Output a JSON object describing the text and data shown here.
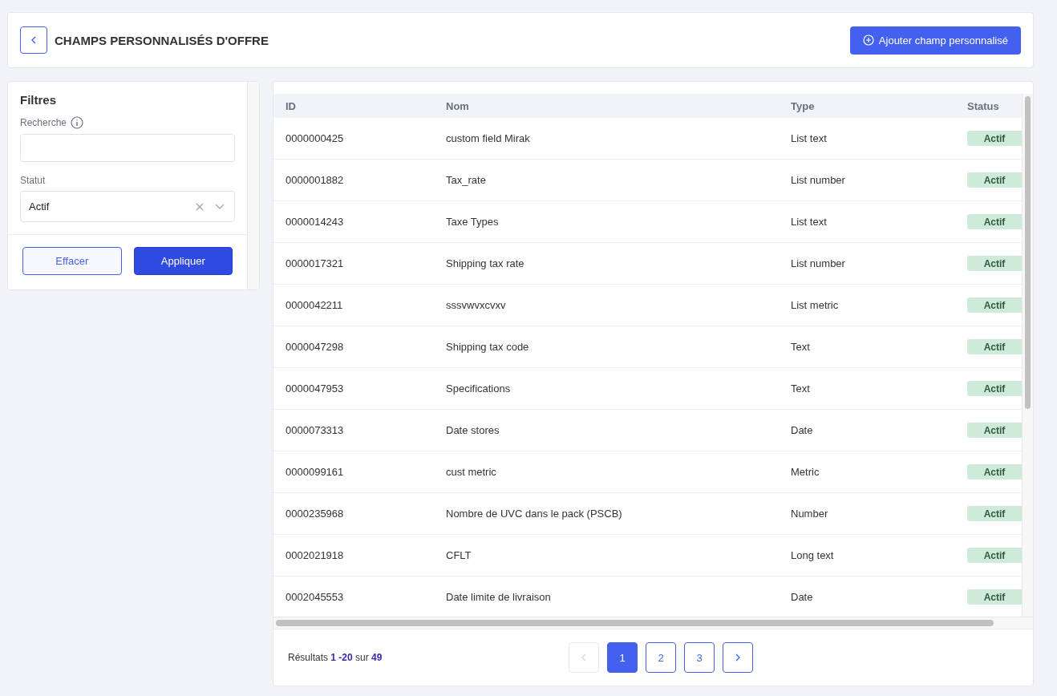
{
  "header": {
    "title": "CHAMPS PERSONNALISÉS D'OFFRE",
    "add_button": "Ajouter champ personnalisé"
  },
  "filters": {
    "title": "Filtres",
    "search": {
      "label": "Recherche"
    },
    "status": {
      "label": "Statut",
      "value": "Actif"
    },
    "buttons": [
      "Effacer",
      "Appliquer"
    ]
  },
  "table": {
    "columns": [
      "ID",
      "Nom",
      "Type",
      "Status"
    ],
    "rows": [
      {
        "id": "0000000425",
        "name": "custom field Mirak",
        "type": "List text",
        "status": "Actif"
      },
      {
        "id": "0000001882",
        "name": "Tax_rate",
        "type": "List number",
        "status": "Actif"
      },
      {
        "id": "0000014243",
        "name": "Taxe Types",
        "type": "List text",
        "status": "Actif"
      },
      {
        "id": "0000017321",
        "name": "Shipping tax rate",
        "type": "List number",
        "status": "Actif"
      },
      {
        "id": "0000042211",
        "name": "sssvwvxcvxv",
        "type": "List metric",
        "status": "Actif"
      },
      {
        "id": "0000047298",
        "name": "Shipping tax code",
        "type": "Text",
        "status": "Actif"
      },
      {
        "id": "0000047953",
        "name": "Specifications",
        "type": "Text",
        "status": "Actif"
      },
      {
        "id": "0000073313",
        "name": "Date stores",
        "type": "Date",
        "status": "Actif"
      },
      {
        "id": "0000099161",
        "name": "cust metric",
        "type": "Metric",
        "status": "Actif"
      },
      {
        "id": "0000235968",
        "name": "Nombre de UVC dans le pack (PSCB)",
        "type": "Number",
        "status": "Actif"
      },
      {
        "id": "0002021918",
        "name": "CFLT",
        "type": "Long text",
        "status": "Actif"
      },
      {
        "id": "0002045553",
        "name": "Date limite de livraison",
        "type": "Date",
        "status": "Actif"
      }
    ]
  },
  "footer": {
    "results": "Résultats **1 -20** sur **49**",
    "prev_disabled": true,
    "pages": [
      {
        "label": "1",
        "selected": true
      },
      {
        "label": "2",
        "selected": false
      },
      {
        "label": "3",
        "selected": false
      }
    ],
    "next_disabled": false
  }
}
